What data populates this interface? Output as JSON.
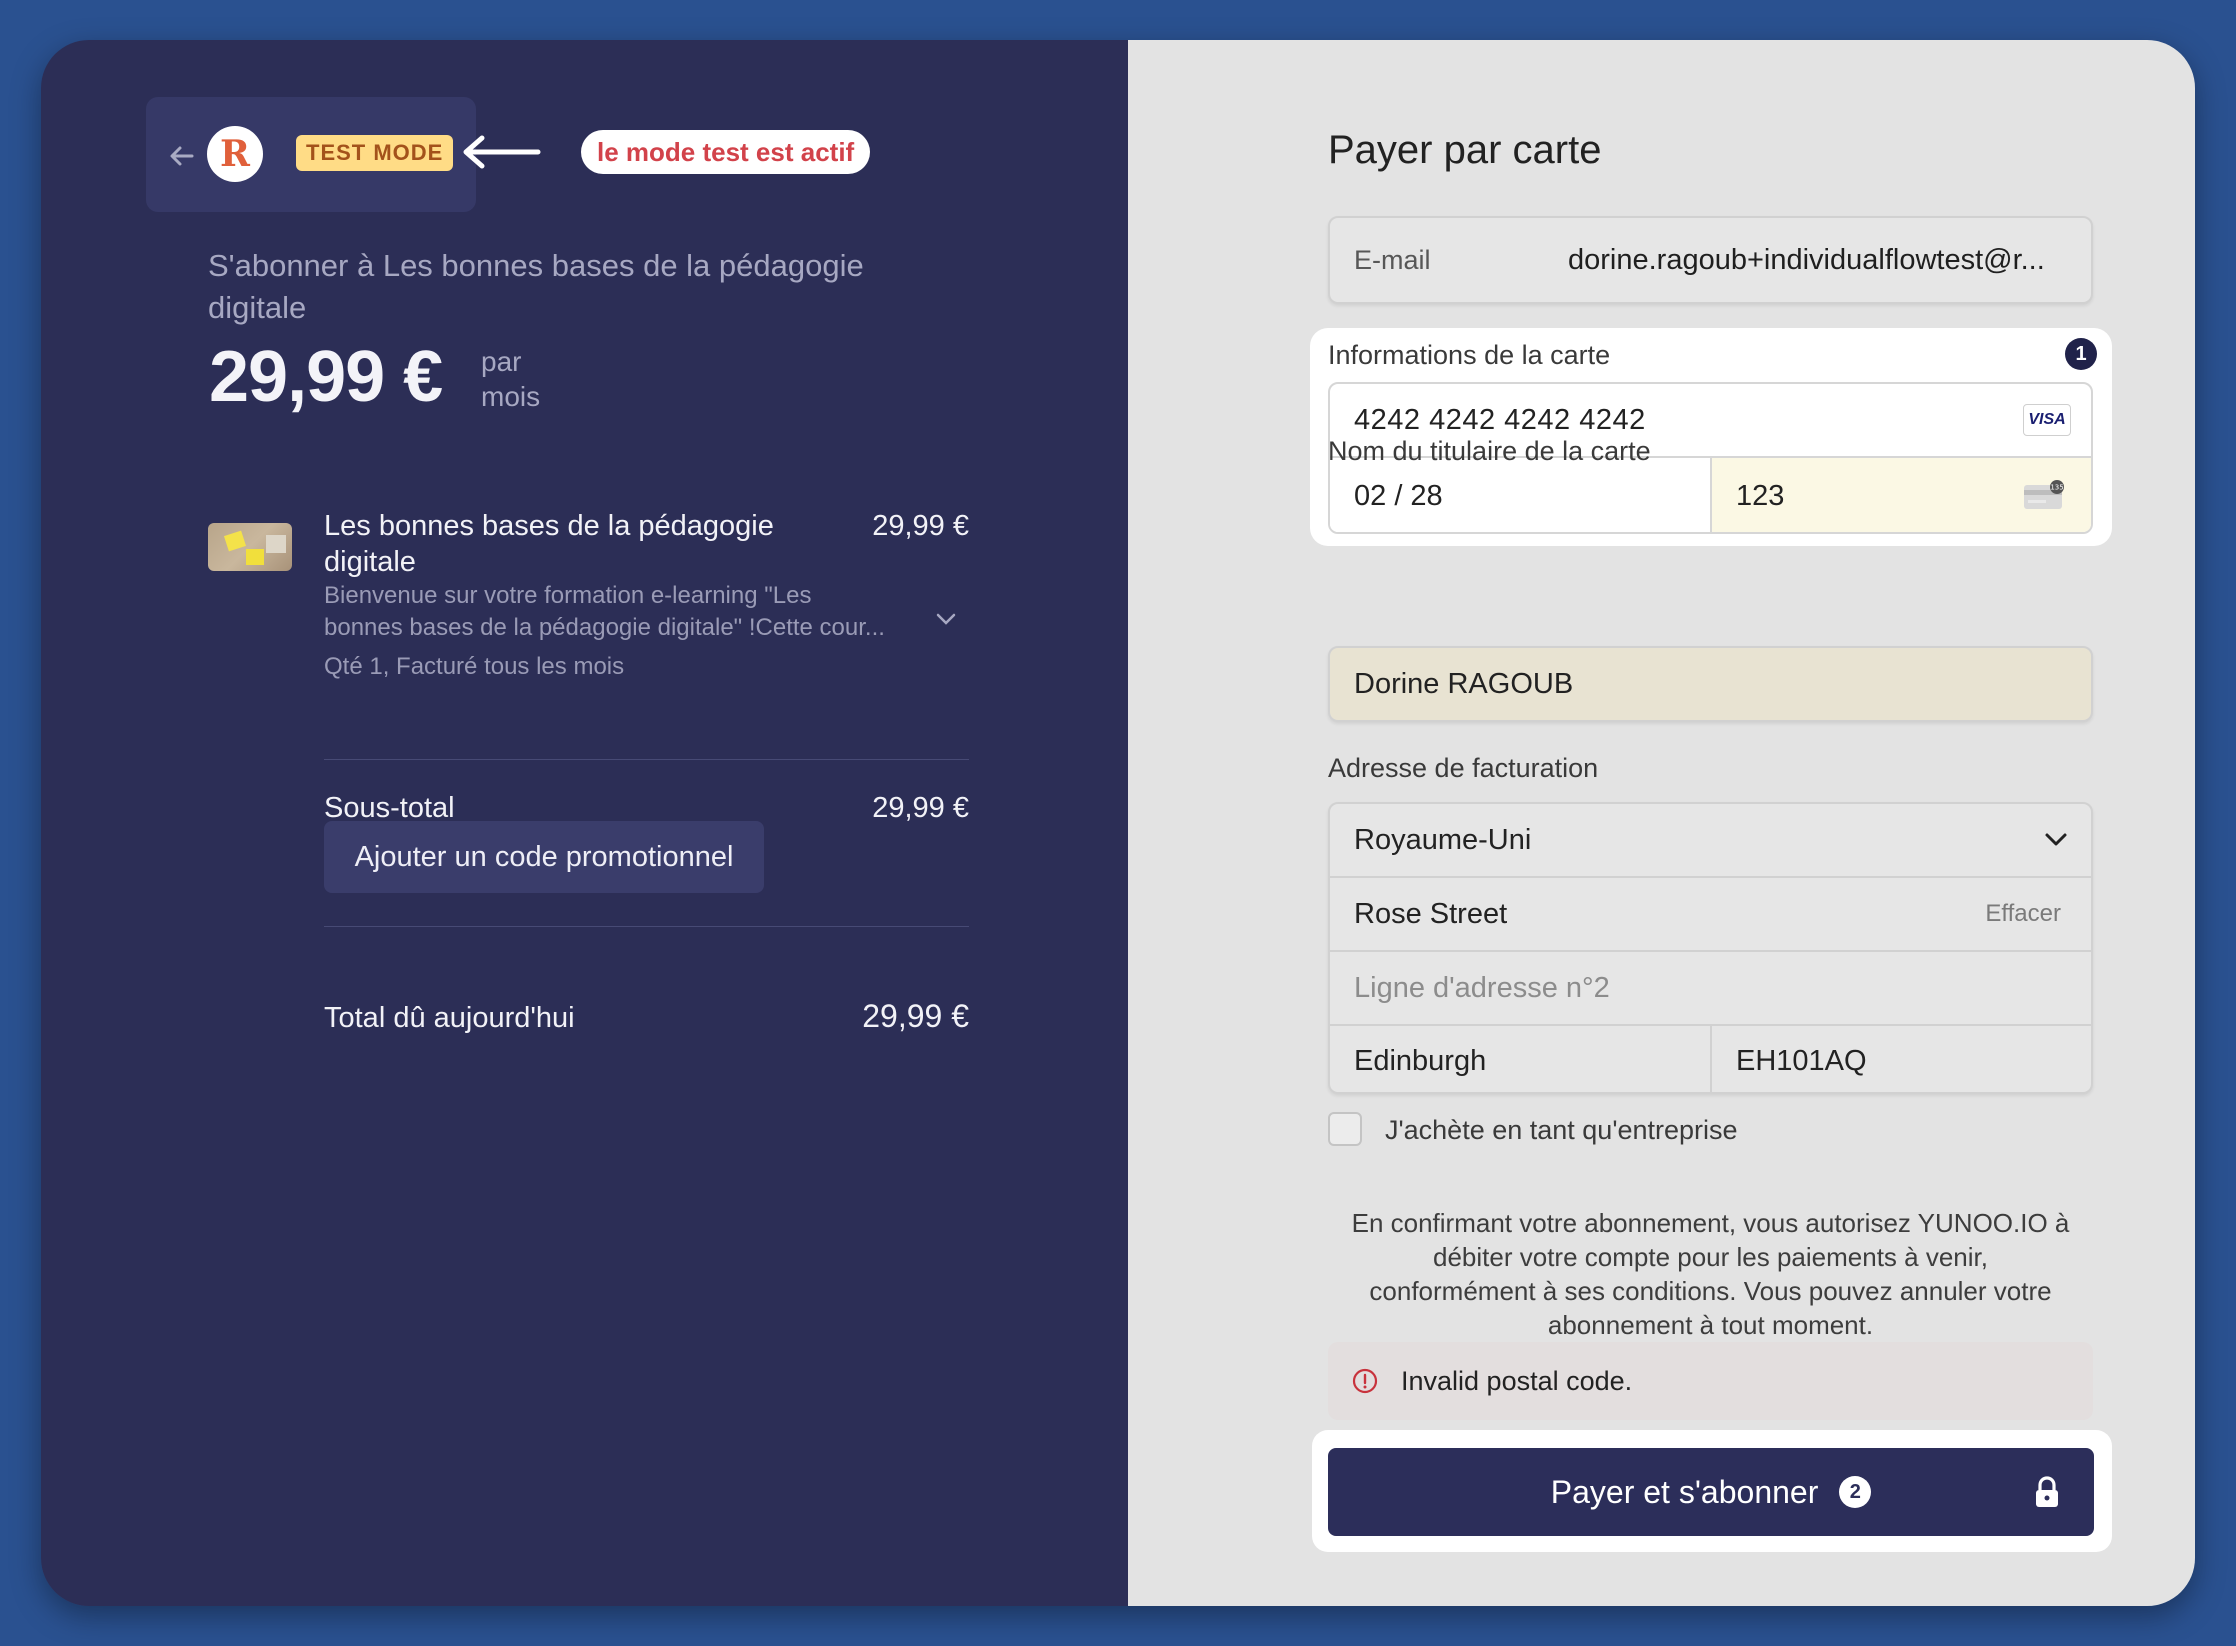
{
  "header": {
    "back_icon": "arrow-left-icon",
    "logo_letter": "R",
    "test_badge": "TEST MODE",
    "annotation": "le mode test est actif"
  },
  "summary": {
    "subscribe_title": "S'abonner à Les bonnes bases de la pédagogie digitale",
    "price": "29,99 €",
    "price_unit_line1": "par",
    "price_unit_line2": "mois"
  },
  "item": {
    "title": "Les bonnes bases de la pédagogie digitale",
    "price": "29,99 €",
    "description_line1": "Bienvenue sur votre formation e-learning \"Les",
    "description_line2": "bonnes bases de la pédagogie digitale\" !Cette cour...",
    "quantity": "Qté 1, Facturé tous les mois"
  },
  "totals": {
    "subtotal_label": "Sous-total",
    "subtotal_value": "29,99 €",
    "promo_button": "Ajouter un code promotionnel",
    "total_label": "Total dû aujourd'hui",
    "total_value": "29,99 €"
  },
  "payment": {
    "title": "Payer par carte",
    "email_label": "E-mail",
    "email_value": "dorine.ragoub+individualflowtest@r...",
    "card_info_label": "Informations de la carte",
    "badge_1": "1",
    "card_number": "4242 4242 4242 4242",
    "card_brand": "VISA",
    "card_expiry": "02 / 28",
    "card_cvc": "123",
    "cvc_icon_text": "135",
    "cardholder_label": "Nom du titulaire de la carte",
    "cardholder_value": "Dorine RAGOUB",
    "billing_label": "Adresse de facturation",
    "country": "Royaume-Uni",
    "address_line1": "Rose Street",
    "clear_label": "Effacer",
    "address_line2_placeholder": "Ligne d'adresse n°2",
    "city": "Edinburgh",
    "postal_code": "EH101AQ",
    "business_checkbox_label": "J'achète en tant qu'entreprise",
    "legal_line1": "En confirmant votre abonnement, vous autorisez YUNOO.IO à",
    "legal_line2": "débiter votre compte pour les paiements à venir,",
    "legal_line3": "conformément à ses conditions. Vous pouvez annuler votre",
    "legal_line4": "abonnement à tout moment.",
    "error_message": "Invalid postal code.",
    "pay_button": "Payer et s'abonner",
    "badge_2": "2"
  },
  "colors": {
    "left_panel": "#2c2e56",
    "right_panel": "#e3e3e3",
    "pay_button": "#2c2e5a",
    "test_badge": "#ffdc86",
    "annotation_text": "#d2424a"
  }
}
